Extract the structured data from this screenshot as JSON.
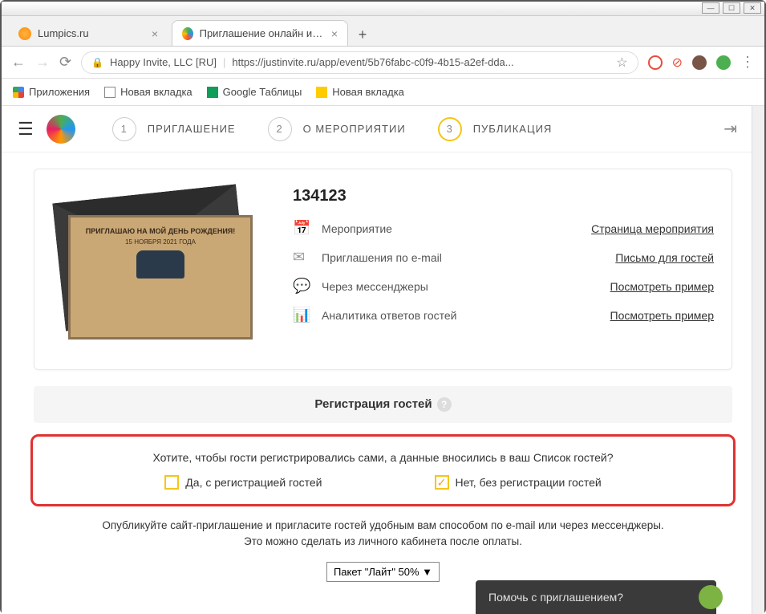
{
  "window": {
    "min": "—",
    "max": "☐",
    "close": "✕"
  },
  "tabs": [
    {
      "title": "Lumpics.ru"
    },
    {
      "title": "Приглашение онлайн и сайт м"
    }
  ],
  "addr": {
    "company": "Happy Invite, LLC [RU]",
    "url": "https://justinvite.ru/app/event/5b76fabc-c0f9-4b15-a2ef-dda..."
  },
  "bookmarks": {
    "apps": "Приложения",
    "newtab1": "Новая вкладка",
    "sheets": "Google Таблицы",
    "newtab2": "Новая вкладка"
  },
  "steps": [
    {
      "n": "1",
      "label": "ПРИГЛАШЕНИЕ"
    },
    {
      "n": "2",
      "label": "О МЕРОПРИЯТИИ"
    },
    {
      "n": "3",
      "label": "ПУБЛИКАЦИЯ"
    }
  ],
  "invite_thumb": {
    "line1": "ПРИГЛАШАЮ НА МОЙ ДЕНЬ РОЖДЕНИЯ!",
    "line2": "15 НОЯБРЯ 2021 ГОДА"
  },
  "event": {
    "title": "134123",
    "rows": [
      {
        "icon": "📅",
        "label": "Мероприятие",
        "link": "Страница мероприятия"
      },
      {
        "icon": "✉",
        "label": "Приглашения по e-mail",
        "link": "Письмо для гостей"
      },
      {
        "icon": "💬",
        "label": "Через мессенджеры",
        "link": "Посмотреть пример"
      },
      {
        "icon": "📊",
        "label": "Аналитика ответов гостей",
        "link": "Посмотреть пример"
      }
    ]
  },
  "section": "Регистрация гостей",
  "reg": {
    "q": "Хотите, чтобы гости регистрировались сами, а данные вносились в ваш Список гостей?",
    "opt1": "Да, с регистрацией гостей",
    "opt2": "Нет, без регистрации гостей"
  },
  "publish_note": "Опубликуйте сайт-приглашение и пригласите гостей удобным вам способом по e-mail или через мессенджеры.\nЭто можно сделать из личного кабинета после оплаты.",
  "package": "Пакет \"Лайт\" 50% ▼",
  "help": "Помочь с приглашением?"
}
